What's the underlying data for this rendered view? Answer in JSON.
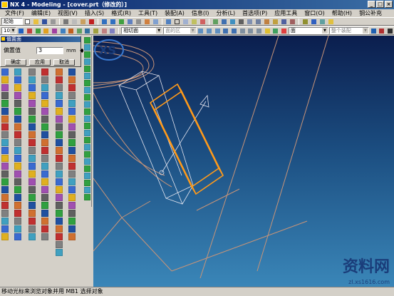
{
  "window": {
    "title": "NX 4 - Modeling - [cover.prt（修改的）]",
    "buttons": [
      "_",
      "□",
      "×"
    ]
  },
  "menu": [
    "文件(F)",
    "编辑(E)",
    "视图(V)",
    "插入(S)",
    "格式(R)",
    "工具(T)",
    "装配(A)",
    "信息(I)",
    "分析(L)",
    "首选项(P)",
    "应用工具",
    "窗口(O)",
    "帮助(H)",
    "钢公补充"
  ],
  "toolbar1": {
    "start_label": "起始"
  },
  "toolbar2": {
    "zoom_value": "100",
    "filter1": "相切面",
    "filter2": "面的区",
    "filter3": "面",
    "filter4": "整个装配"
  },
  "dialog": {
    "title": "偏置面",
    "offset_label": "偏置值",
    "offset_value": "3",
    "unit": "mm",
    "ok_label": "确定",
    "apply_label": "应用",
    "cancel_label": "取消"
  },
  "status": "移动光标来浏览对象并用 MB1 选择对象",
  "watermark": {
    "text": "资料网",
    "url": "zl.xs1616.com"
  },
  "colors": {
    "titlebar": "#0a246a",
    "viewport_top": "#0b1e4e",
    "viewport_bottom": "#3a86b8",
    "wire": "#c89478",
    "selected": "#ff9a1a"
  }
}
